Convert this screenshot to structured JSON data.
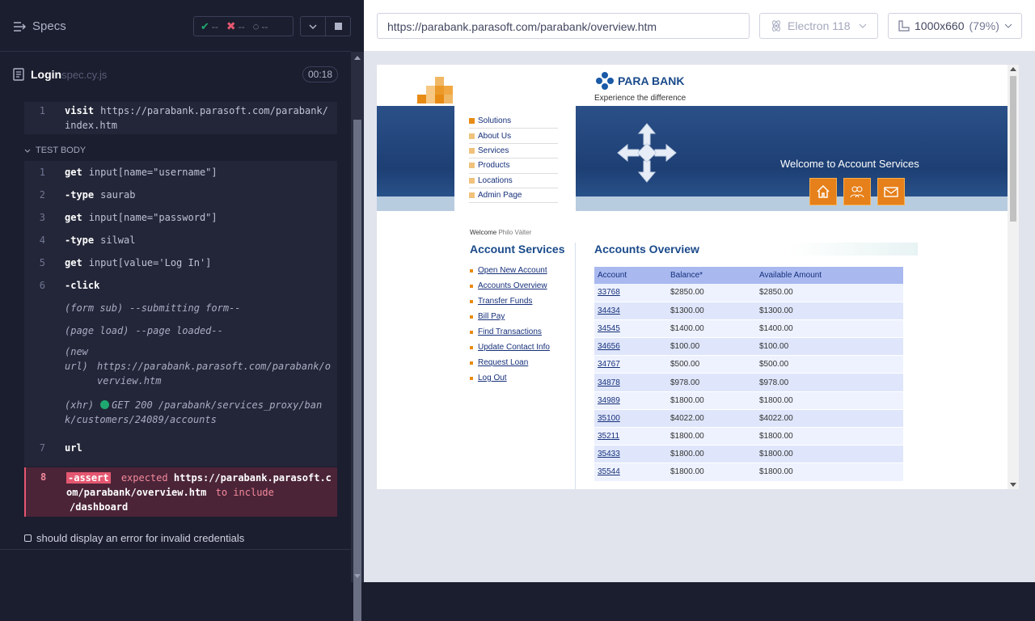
{
  "sidebar": {
    "specs_label": "Specs",
    "stats": {
      "passed": "--",
      "failed": "--",
      "pending": "--"
    },
    "spec_name": "Login",
    "spec_ext": "spec.cy.js",
    "timer": "00:18",
    "before_line": {
      "num": "1",
      "cmd": "visit",
      "arg": "https://parabank.parasoft.com/parabank/index.htm"
    },
    "section_label": "TEST BODY",
    "commands": [
      {
        "num": "1",
        "cmd": "get",
        "arg": "input[name=\"username\"]"
      },
      {
        "num": "2",
        "cmd": "-type",
        "arg": "saurab"
      },
      {
        "num": "3",
        "cmd": "get",
        "arg": "input[name=\"password\"]"
      },
      {
        "num": "4",
        "cmd": "-type",
        "arg": "silwal"
      },
      {
        "num": "5",
        "cmd": "get",
        "arg": "input[value='Log In']"
      },
      {
        "num": "6",
        "cmd": "-click",
        "arg": ""
      }
    ],
    "events": [
      {
        "label": "(form sub)",
        "text": "--submitting form--"
      },
      {
        "label": "(page load)",
        "text": "--page loaded--"
      },
      {
        "label": "(new url)",
        "text": "https://parabank.parasoft.com/parabank/overview.htm"
      },
      {
        "label": "(xhr)",
        "text": "GET 200 /parabank/services_proxy/bank/customers/24089/accounts"
      }
    ],
    "url_line": {
      "num": "7",
      "cmd": "url"
    },
    "assert_line": {
      "num": "8",
      "cmd": "-assert",
      "text1": "expected",
      "url": "https://parabank.parasoft.com/parabank/overview.htm",
      "text2": "to include",
      "target": "/dashboard"
    },
    "next_test": "should display an error for invalid credentials"
  },
  "toolbar": {
    "url": "https://parabank.parasoft.com/parabank/overview.htm",
    "browser": "Electron 118",
    "viewport": "1000x660",
    "scale": "(79%)"
  },
  "app": {
    "brand": "PARA BANK",
    "tagline": "Experience the difference",
    "menu": [
      "Solutions",
      "About Us",
      "Services",
      "Products",
      "Locations",
      "Admin Page"
    ],
    "hero_text": "Welcome to Account Services",
    "welcome_label": "Welcome",
    "user_name": "Philo Vàlter",
    "account_services_title": "Account Services",
    "side_links": [
      "Open New Account",
      "Accounts Overview",
      "Transfer Funds",
      "Bill Pay",
      "Find Transactions",
      "Update Contact Info",
      "Request Loan",
      "Log Out"
    ],
    "overview_title": "Accounts Overview",
    "columns": [
      "Account",
      "Balance*",
      "Available Amount"
    ],
    "accounts": [
      [
        "33768",
        "$2850.00",
        "$2850.00"
      ],
      [
        "34434",
        "$1300.00",
        "$1300.00"
      ],
      [
        "34545",
        "$1400.00",
        "$1400.00"
      ],
      [
        "34656",
        "$100.00",
        "$100.00"
      ],
      [
        "34767",
        "$500.00",
        "$500.00"
      ],
      [
        "34878",
        "$978.00",
        "$978.00"
      ],
      [
        "34989",
        "$1800.00",
        "$1800.00"
      ],
      [
        "35100",
        "$4022.00",
        "$4022.00"
      ],
      [
        "35211",
        "$1800.00",
        "$1800.00"
      ],
      [
        "35433",
        "$1800.00",
        "$1800.00"
      ],
      [
        "35544",
        "$1800.00",
        "$1800.00"
      ]
    ]
  }
}
